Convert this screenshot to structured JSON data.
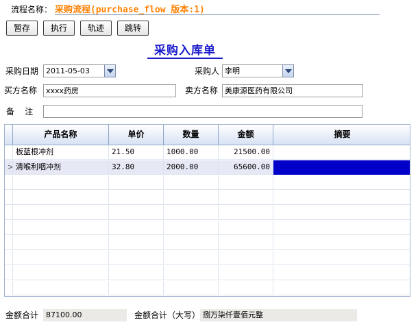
{
  "flow": {
    "label": "流程名称：",
    "name": "采购流程(purchase_flow 版本:1)"
  },
  "toolbar": {
    "save_label": "暂存",
    "execute_label": "执行",
    "track_label": "轨迹",
    "jump_label": "跳转"
  },
  "form": {
    "title": "采购入库单",
    "purchase_date_label": "采购日期",
    "purchase_date": "2011-05-03",
    "purchaser_label": "采购人",
    "purchaser": "李明",
    "buyer_label": "买方名称",
    "buyer": "xxxx药房",
    "seller_label": "卖方名称",
    "seller": "美康源医药有限公司",
    "remark_label": "备    注",
    "remark": ""
  },
  "grid": {
    "columns": [
      "产品名称",
      "单价",
      "数量",
      "金额",
      "摘要"
    ],
    "rows": [
      {
        "product": "板蓝根冲剂",
        "price": "21.50",
        "qty": "1000.00",
        "amount": "21500.00",
        "summary": ""
      },
      {
        "product": "清喉利咽冲剂",
        "price": "32.80",
        "qty": "2000.00",
        "amount": "65600.00",
        "summary": ""
      }
    ],
    "selected_row": 1,
    "selection_color": "#0000c8"
  },
  "totals": {
    "sum_label": "金额合计",
    "sum_value": "87100.00",
    "sum_upper_label": "金额合计（大写）",
    "sum_upper_value": "捌万柒仟壹佰元整"
  },
  "icons": {
    "combo": "chevron-down-icon",
    "row_indicator": "row-pointer-icon"
  }
}
